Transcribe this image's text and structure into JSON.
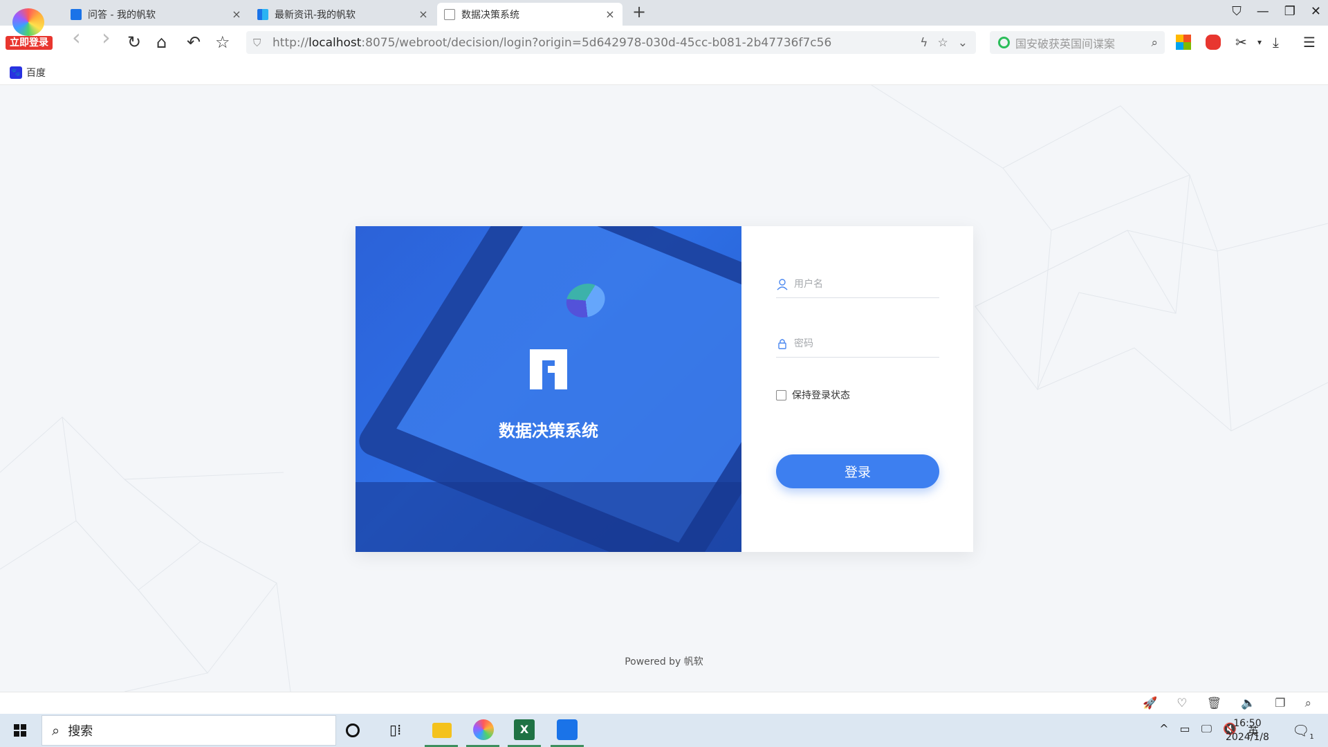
{
  "browser": {
    "login_badge": "立即登录",
    "tabs": [
      {
        "title": "问答 - 我的帆软",
        "close": "×"
      },
      {
        "title": "最新资讯-我的帆软",
        "close": "×"
      },
      {
        "title": "数据决策系统",
        "close": "×"
      }
    ],
    "new_tab": "+",
    "window_controls": {
      "skin": "⛉",
      "minimize": "—",
      "restore": "❐",
      "close": "✕"
    },
    "nav": {
      "back": "‹",
      "forward": "›",
      "reload": "↻",
      "home": "⌂",
      "undo": "↶",
      "favorite": "☆"
    },
    "address": {
      "prefix": "http://",
      "host": "localhost",
      "rest": ":8075/webroot/decision/login?origin=5d642978-030d-45cc-b081-2b47736f7c56",
      "flash": "ϟ",
      "star": "☆",
      "dropdown": "⌄"
    },
    "search": {
      "placeholder": "国安破获英国间谍案",
      "icon": "⌕"
    },
    "toolbar": {
      "cut": "✂",
      "cut_dropdown": "▾",
      "download": "⤓",
      "menu": "☰"
    },
    "bookmarks": [
      {
        "label": "百度",
        "icon": "🐾"
      }
    ]
  },
  "login": {
    "brand_name": "数据决策系统",
    "username_placeholder": "用户名",
    "password_placeholder": "密码",
    "remember_label": "保持登录状态",
    "login_button": "登录",
    "powered_prefix": "Powered by ",
    "powered_brand": "帆软"
  },
  "statusbar": {
    "icons": [
      "🚀",
      "♡",
      "🗑",
      "🔈",
      "❐",
      "⌕"
    ]
  },
  "taskbar": {
    "search_label": "搜索",
    "excel_letter": "X",
    "tray": {
      "chevron": "^",
      "battery": "▭",
      "network": "🖵",
      "mute": "🔇",
      "ime": "英"
    },
    "time": "16:50",
    "date": "2024/1/8",
    "notification_icon": "🗨",
    "notification_count": "1"
  },
  "colors": {
    "accent": "#3d7ff0",
    "panel_blue": "#2e6fe6"
  }
}
